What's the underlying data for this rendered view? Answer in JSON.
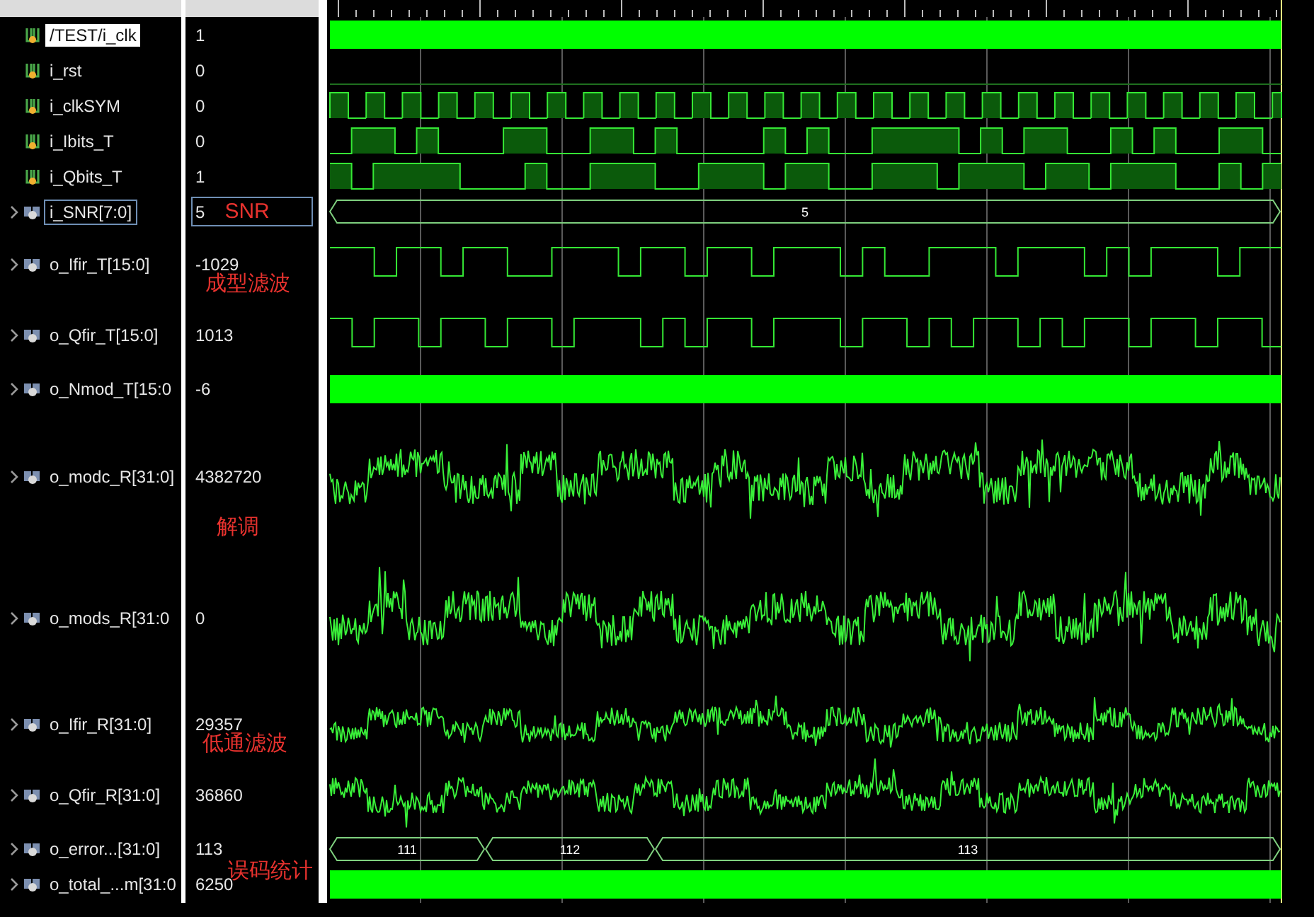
{
  "signals": [
    {
      "name": "/TEST/i_clk",
      "value": "1",
      "kind": "dense",
      "selected": true,
      "outlined": false,
      "expandable": false
    },
    {
      "name": "i_rst",
      "value": "0",
      "kind": "low",
      "selected": false,
      "outlined": false,
      "expandable": false
    },
    {
      "name": "i_clkSYM",
      "value": "0",
      "kind": "clock",
      "selected": false,
      "outlined": false,
      "expandable": false
    },
    {
      "name": "i_Ibits_T",
      "value": "0",
      "kind": "bits",
      "selected": false,
      "outlined": false,
      "expandable": false
    },
    {
      "name": "i_Qbits_T",
      "value": "1",
      "kind": "bits",
      "selected": false,
      "outlined": false,
      "expandable": false
    },
    {
      "name": "i_SNR[7:0]",
      "value": "5",
      "note": "SNR",
      "kind": "bus",
      "segments": [
        {
          "label": "5"
        }
      ],
      "selected": false,
      "outlined": true,
      "expandable": true
    },
    {
      "name": "o_Ifir_T[15:0]",
      "value": "-1029",
      "note": "成型滤波",
      "kind": "square",
      "selected": false,
      "outlined": false,
      "expandable": true
    },
    {
      "name": "o_Qfir_T[15:0]",
      "value": "1013",
      "kind": "square",
      "selected": false,
      "outlined": false,
      "expandable": true
    },
    {
      "name": "o_Nmod_T[15:0",
      "value": "-6",
      "kind": "dense",
      "selected": false,
      "outlined": false,
      "expandable": true
    },
    {
      "name": "o_modc_R[31:0]",
      "value": "4382720",
      "note": "解调",
      "kind": "noisy",
      "selected": false,
      "outlined": false,
      "expandable": true
    },
    {
      "name": "o_mods_R[31:0",
      "value": "0",
      "kind": "noisy",
      "selected": false,
      "outlined": false,
      "expandable": true
    },
    {
      "name": "o_Ifir_R[31:0]",
      "value": "29357",
      "note": "低通滤波",
      "kind": "noisy",
      "selected": false,
      "outlined": false,
      "expandable": true
    },
    {
      "name": "o_Qfir_R[31:0]",
      "value": "36860",
      "kind": "noisy",
      "selected": false,
      "outlined": false,
      "expandable": true
    },
    {
      "name": "o_error...[31:0]",
      "value": "113",
      "note": "误码统计",
      "kind": "bus",
      "segments": [
        {
          "label": "111"
        },
        {
          "label": "112"
        },
        {
          "label": "113"
        }
      ],
      "selected": false,
      "outlined": false,
      "expandable": true
    },
    {
      "name": "o_total_...m[31:0",
      "value": "6250",
      "kind": "dense",
      "selected": false,
      "outlined": false,
      "expandable": true
    }
  ]
}
